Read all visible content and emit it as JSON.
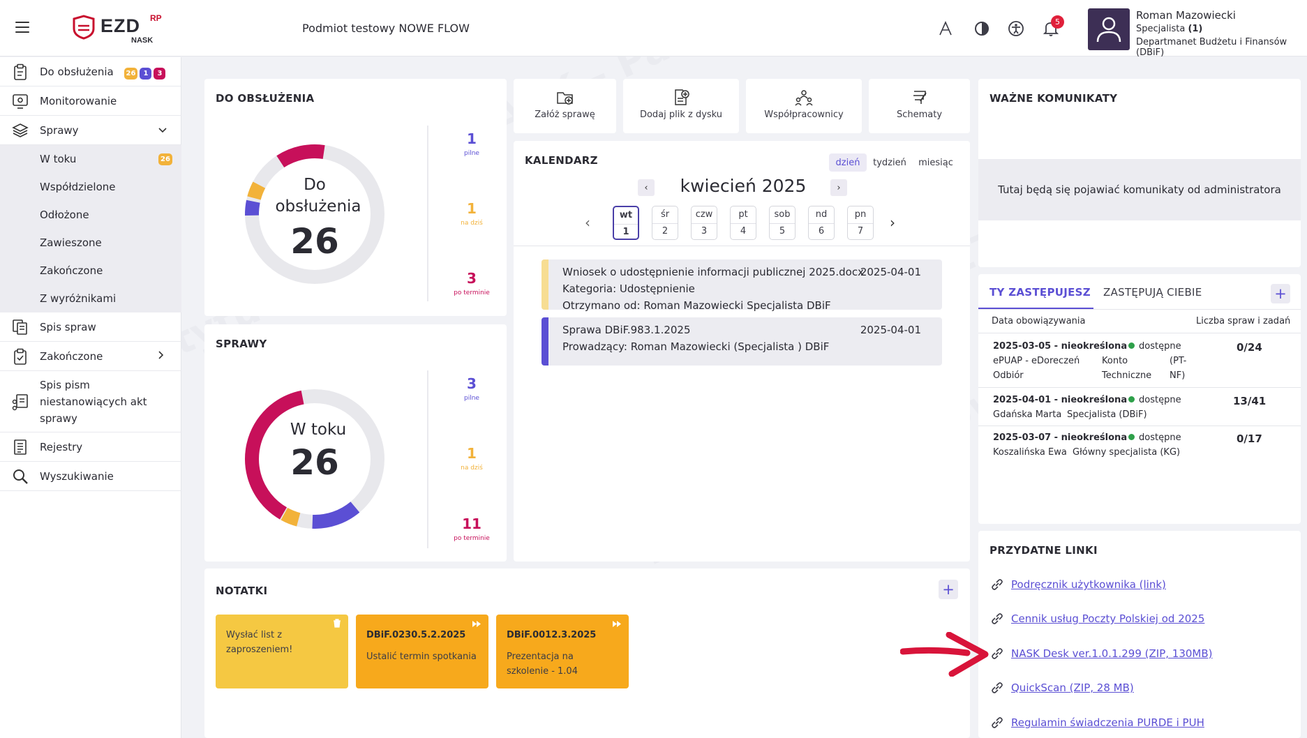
{
  "header": {
    "logo_text": "EZD",
    "logo_rp": "RP",
    "logo_nask": "NASK",
    "org_name": "Podmiot testowy NOWE FLOW",
    "notification_count": "5",
    "user_name": "Roman Mazowiecki",
    "user_role": "Specjalista",
    "user_role_suffix": "(1)",
    "user_dept": "Departmanet Budżetu i Finansów (DBiF)",
    "icons": [
      "hamburger-icon",
      "font-size-icon",
      "contrast-icon",
      "accessibility-icon",
      "bell-icon",
      "user-avatar-icon"
    ]
  },
  "sidebar": {
    "items": [
      {
        "label": "Do obsłużenia",
        "icon": "clipboard-icon",
        "badges": [
          "26",
          "1",
          "3"
        ]
      },
      {
        "label": "Monitorowanie",
        "icon": "monitor-eye-icon"
      },
      {
        "label": "Sprawy",
        "icon": "layers-icon"
      },
      {
        "label": "Spis spraw",
        "icon": "documents-icon"
      },
      {
        "label": "Zakończone",
        "icon": "clipboard-check-icon"
      },
      {
        "label": "Spis pism niestanowiących akt sprawy",
        "icon": "share-docs-icon"
      },
      {
        "label": "Rejestry",
        "icon": "register-icon"
      },
      {
        "label": "Wyszukiwanie",
        "icon": "search-icon"
      }
    ],
    "subitems": [
      {
        "label": "W toku",
        "badge": "26"
      },
      {
        "label": "Współdzielone"
      },
      {
        "label": "Odłożone"
      },
      {
        "label": "Zawieszone"
      },
      {
        "label": "Zakończone"
      },
      {
        "label": "Z wyróżnikami"
      }
    ]
  },
  "do_obsluzenia": {
    "title": "DO OBSŁUŻENIA",
    "center_label_1": "Do",
    "center_label_2": "obsłużenia",
    "total": "26",
    "stats": [
      {
        "value": "1",
        "label": "pilne",
        "color": "#5b4fd4"
      },
      {
        "value": "1",
        "label": "na dziś",
        "color": "#f2b23a"
      },
      {
        "value": "3",
        "label": "po terminie",
        "color": "#c7105a"
      }
    ]
  },
  "sprawy": {
    "title": "SPRAWY",
    "center_label": "W toku",
    "total": "26",
    "stats": [
      {
        "value": "3",
        "label": "pilne",
        "color": "#5b4fd4"
      },
      {
        "value": "1",
        "label": "na dziś",
        "color": "#f2b23a"
      },
      {
        "value": "11",
        "label": "po terminie",
        "color": "#c7105a"
      }
    ]
  },
  "actions": [
    {
      "label": "Załóż sprawę",
      "icon": "folder-add-icon"
    },
    {
      "label": "Dodaj plik z dysku",
      "icon": "file-add-icon"
    },
    {
      "label": "Współpracownicy",
      "icon": "team-icon"
    },
    {
      "label": "Schematy",
      "icon": "scheme-icon"
    }
  ],
  "calendar": {
    "title": "KALENDARZ",
    "views": [
      "dzień",
      "tydzień",
      "miesiąc"
    ],
    "active_view": "dzień",
    "month_label": "kwiecień 2025",
    "days": [
      {
        "name": "wt",
        "num": "1"
      },
      {
        "name": "śr",
        "num": "2"
      },
      {
        "name": "czw",
        "num": "3"
      },
      {
        "name": "pt",
        "num": "4"
      },
      {
        "name": "sob",
        "num": "5"
      },
      {
        "name": "nd",
        "num": "6"
      },
      {
        "name": "pn",
        "num": "7"
      }
    ],
    "events": [
      {
        "line1": "Wniosek o udostępnienie informacji publicznej 2025.docx",
        "line2": "Kategoria: Udostępnienie",
        "line3": "Otrzymano od: Roman Mazowiecki Specjalista DBiF",
        "date": "2025-04-01",
        "color": "#f7dd93"
      },
      {
        "line1": "Sprawa DBiF.983.1.2025",
        "line2": "Prowadzący: Roman Mazowiecki (Specjalista ) DBiF",
        "date": "2025-04-01",
        "color": "#5b4fd4"
      }
    ]
  },
  "notatki": {
    "title": "NOTATKI",
    "notes": [
      {
        "title": "",
        "text": "Wysłać list z zaproszeniem!",
        "color": "#f5c842",
        "icon": "trash-icon"
      },
      {
        "title": "DBiF.0230.5.2.2025",
        "text": "Ustalić termin spotkania",
        "color": "#f7a91c",
        "icon": "fast-forward-icon"
      },
      {
        "title": "DBiF.0012.3.2025",
        "text": "Prezentacja na szkolenie - 1.04",
        "color": "#f7a91c",
        "icon": "fast-forward-icon"
      }
    ]
  },
  "komunikaty": {
    "title": "WAŻNE KOMUNIKATY",
    "message": "Tutaj będą się pojawiać komunikaty od administratora"
  },
  "zastepstwa": {
    "tabs": [
      "TY ZASTĘPUJESZ",
      "ZASTĘPUJĄ CIEBIE"
    ],
    "col_left": "Data obowiązywania",
    "col_right": "Liczba spraw i zadań",
    "rows": [
      {
        "date": "2025-03-05 - nieokreślona",
        "status": "dostępne",
        "count": "0/24",
        "sub_left": "ePUAP - eDoreczeń Odbiór",
        "sub_mid": "Konto Techniczne",
        "sub_right": "(PT-NF)"
      },
      {
        "date": "2025-04-01 - nieokreślona",
        "status": "dostępne",
        "count": "13/41",
        "sub_left": "Gdańska Marta",
        "sub_mid": "Specjalista (DBiF)",
        "sub_right": ""
      },
      {
        "date": "2025-03-07 - nieokreślona",
        "status": "dostępne",
        "count": "0/17",
        "sub_left": "Koszalińska Ewa",
        "sub_mid": "Główny specjalista (KG)",
        "sub_right": ""
      }
    ]
  },
  "linki": {
    "title": "PRZYDATNE LINKI",
    "items": [
      "Podręcznik użytkownika (link)",
      "Cennik usług Poczty Polskiej od 2025",
      "NASK Desk ver.1.0.1.299 (ZIP, 130MB)",
      "QuickScan (ZIP, 28 MB)",
      "Regulamin świadczenia PURDE i PUH"
    ]
  },
  "colors": {
    "accent": "#5b4fd4",
    "magenta": "#c7105a",
    "orange": "#f2b23a",
    "arrow": "#d8143a"
  }
}
